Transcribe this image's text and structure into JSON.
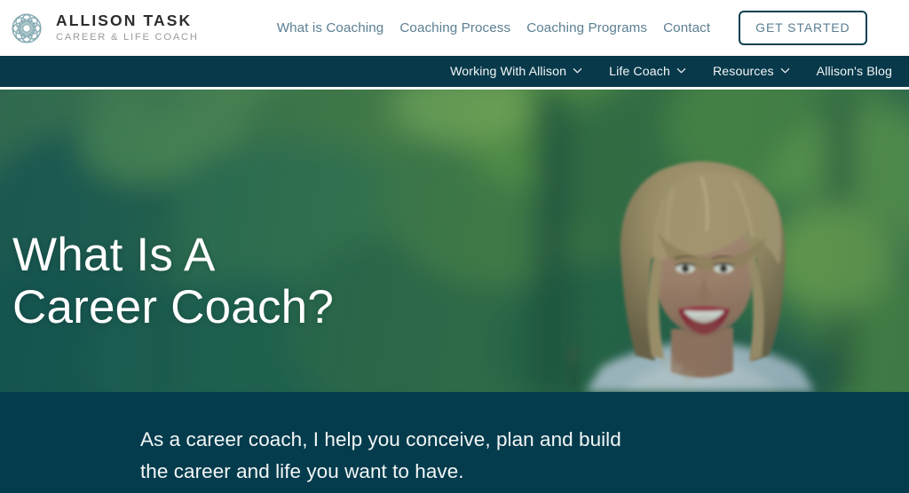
{
  "brand": {
    "name": "ALLISON TASK",
    "tagline": "CAREER & LIFE COACH",
    "logo_icon": "celtic-knot-circle-logo"
  },
  "header": {
    "nav_items": [
      {
        "label": "What is Coaching"
      },
      {
        "label": "Coaching Process"
      },
      {
        "label": "Coaching Programs"
      },
      {
        "label": "Contact"
      }
    ],
    "cta_label": "GET STARTED"
  },
  "secondary_nav": {
    "items": [
      {
        "label": "Working With Allison",
        "has_dropdown": true,
        "icon": "chevron-down-icon"
      },
      {
        "label": "Life Coach",
        "has_dropdown": true,
        "icon": "chevron-down-icon"
      },
      {
        "label": "Resources",
        "has_dropdown": true,
        "icon": "chevron-down-icon"
      },
      {
        "label": "Allison's Blog",
        "has_dropdown": false,
        "icon": ""
      }
    ]
  },
  "hero": {
    "title": "What Is A\nCareer Coach?",
    "image_alt": "smiling woman with blonde bob haircut outdoors among green foliage"
  },
  "bottom": {
    "copy": "As a career coach, I help you conceive, plan and build\nthe career and life you want to have."
  },
  "colors": {
    "dark_teal": "#07394a",
    "bottom_band": "#043c4e",
    "nav_link": "#5b7f93",
    "brand_dark": "#2d2d2d",
    "brand_gray": "#9b9b9b",
    "logo_teal": "#7ea5ad"
  }
}
